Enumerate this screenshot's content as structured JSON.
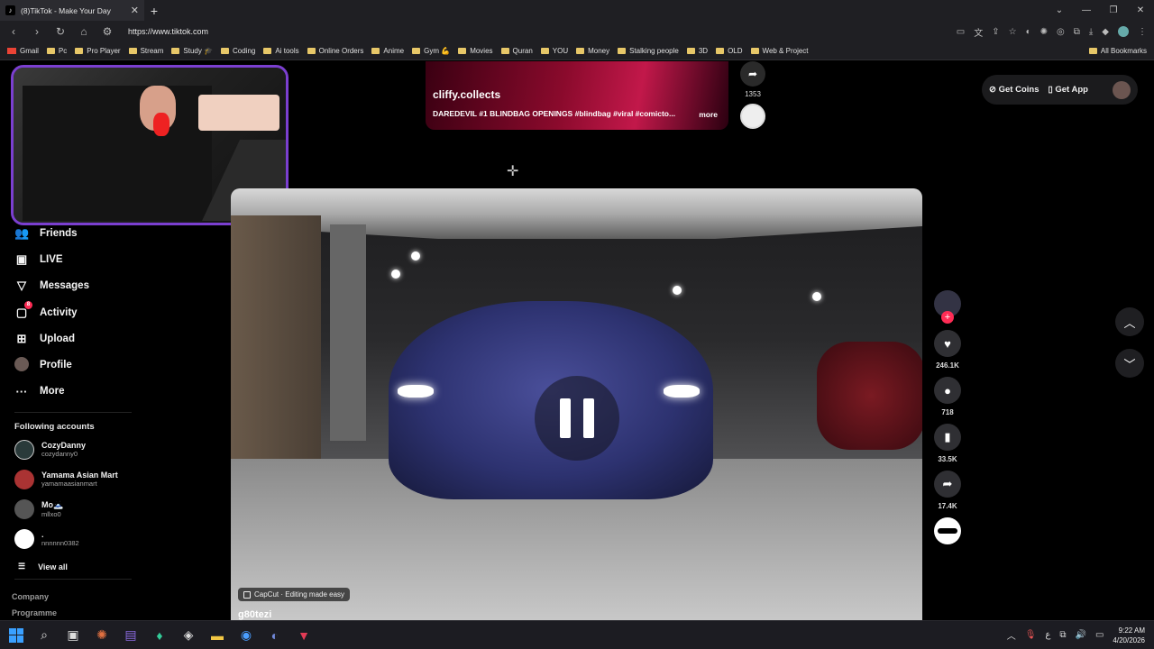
{
  "browser": {
    "tab_title": "(8)TikTok - Make Your Day",
    "tab_close": "✕",
    "new_tab": "+",
    "url": "https://www.tiktok.com",
    "bookmarks": [
      "Gmail",
      "Pc",
      "Pro Player",
      "Stream",
      "Study 🎓",
      "Coding",
      "Ai tools",
      "Online Orders",
      "Anime",
      "Gym 💪",
      "Movies",
      "Quran",
      "YOU",
      "Money",
      "Stalking people",
      "3D",
      "OLD",
      "Web & Project"
    ],
    "all_bookmarks": "All Bookmarks"
  },
  "sidebar": {
    "nav": [
      {
        "label": "Friends",
        "icon": "friends-icon"
      },
      {
        "label": "LIVE",
        "icon": "live-icon"
      },
      {
        "label": "Messages",
        "icon": "messages-icon"
      },
      {
        "label": "Activity",
        "icon": "activity-icon",
        "badge": "8"
      },
      {
        "label": "Upload",
        "icon": "upload-icon"
      },
      {
        "label": "Profile",
        "icon": "profile-icon"
      },
      {
        "label": "More",
        "icon": "more-icon"
      }
    ],
    "following_title": "Following accounts",
    "accounts": [
      {
        "name": "CozyDanny",
        "user": "cozydanny0"
      },
      {
        "name": "Yamama Asian Mart",
        "user": "yamamaasianmart"
      },
      {
        "name": "Mo🗻",
        "user": "mllxo0"
      },
      {
        "name": ".",
        "user": "nnnnnn0382"
      }
    ],
    "view_all": "View all",
    "footer": [
      "Company",
      "Programme"
    ]
  },
  "prev_video": {
    "username": "cliffy.collects",
    "description": "DAREDEVIL #1 BLINDBAG OPENINGS #blindbag #viral #comicto...",
    "more": "more",
    "share_count": "1353"
  },
  "video": {
    "capcut_label": "CapCut · Editing made easy",
    "username": "g80tezi"
  },
  "actions": {
    "likes": "246.1K",
    "comments": "718",
    "saves": "33.5K",
    "shares": "17.4K"
  },
  "top_right": {
    "get_coins": "Get Coins",
    "get_app": "Get App"
  },
  "taskbar": {
    "time": "9:22 AM",
    "date": "4/20/2026"
  }
}
